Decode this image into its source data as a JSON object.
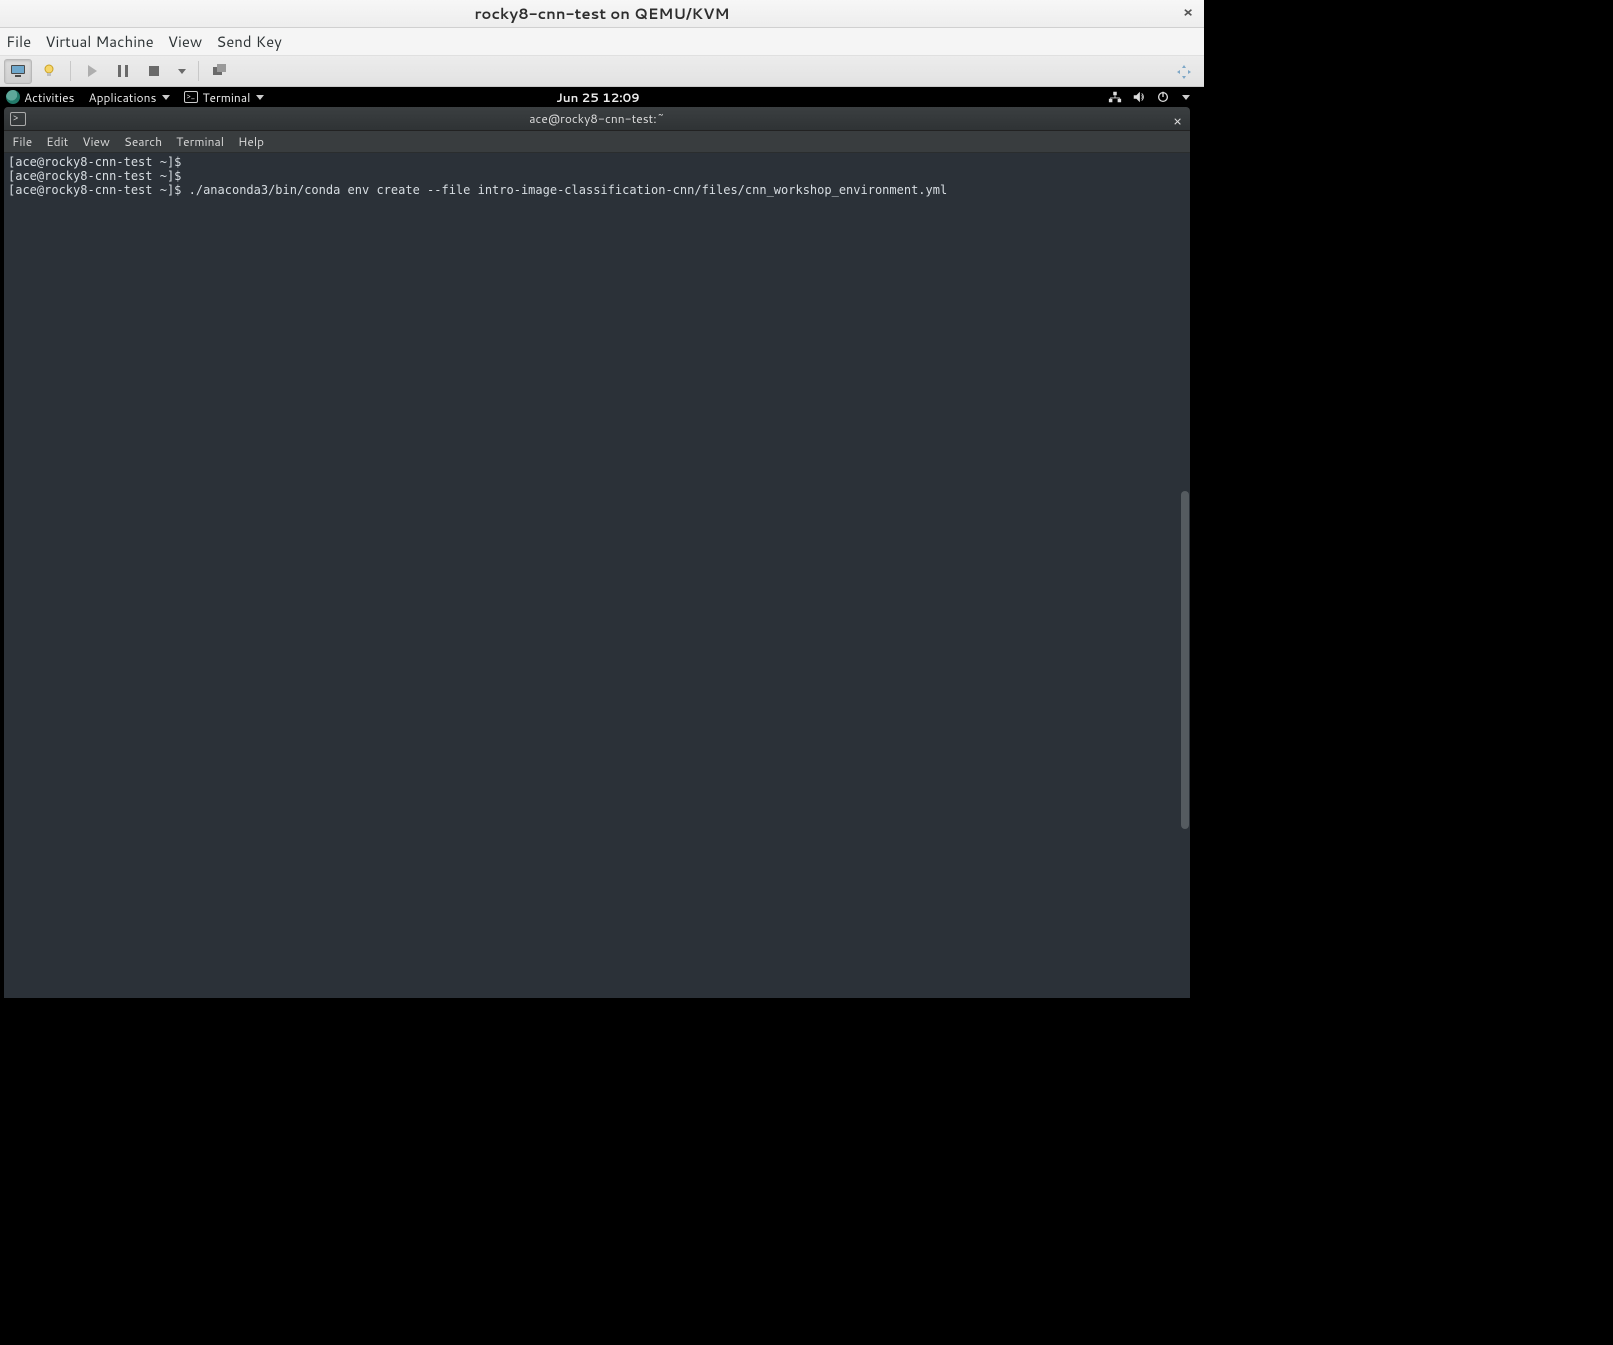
{
  "vm": {
    "title": "rocky8-cnn-test on QEMU/KVM",
    "menus": [
      "File",
      "Virtual Machine",
      "View",
      "Send Key"
    ]
  },
  "gnome": {
    "activities": "Activities",
    "applications": "Applications",
    "terminal_label": "Terminal",
    "clock": "Jun 25  12:09"
  },
  "terminal": {
    "title": "ace@rocky8-cnn-test:~",
    "menus": [
      "File",
      "Edit",
      "View",
      "Search",
      "Terminal",
      "Help"
    ],
    "lines": [
      "[ace@rocky8-cnn-test ~]$",
      "[ace@rocky8-cnn-test ~]$",
      "[ace@rocky8-cnn-test ~]$ ./anaconda3/bin/conda env create --file intro-image-classification-cnn/files/cnn_workshop_environment.yml"
    ]
  }
}
